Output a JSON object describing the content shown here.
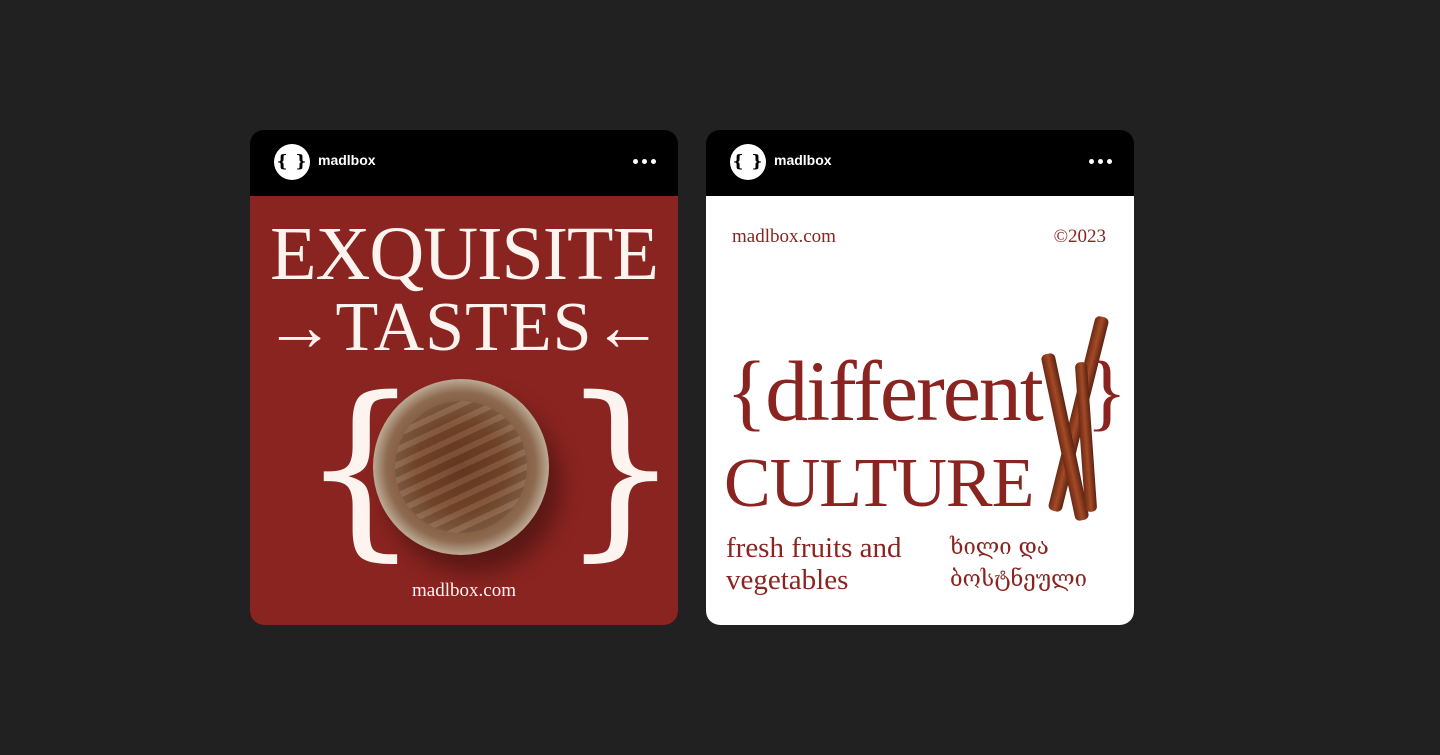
{
  "left_post": {
    "avatar_text": "{ }",
    "username": "madlbox",
    "title_line1": "EXQUISITE",
    "title_line2": "→TASTES←",
    "brace_open": "{",
    "brace_close": "}",
    "url": "madlbox.com"
  },
  "right_post": {
    "avatar_text": "{ }",
    "username": "madlbox",
    "url": "madlbox.com",
    "year": "©2023",
    "headline1": "{different",
    "brace_close": "}",
    "headline2": "CULTURE",
    "caption_en": "fresh fruits and vegetables",
    "caption_ka": "ხილი და ბოსტნეული"
  },
  "icons": {
    "more": "more-options-icon"
  },
  "colors": {
    "background": "#212121",
    "brand_red": "#8a2420",
    "cream": "#fdf4ef"
  }
}
